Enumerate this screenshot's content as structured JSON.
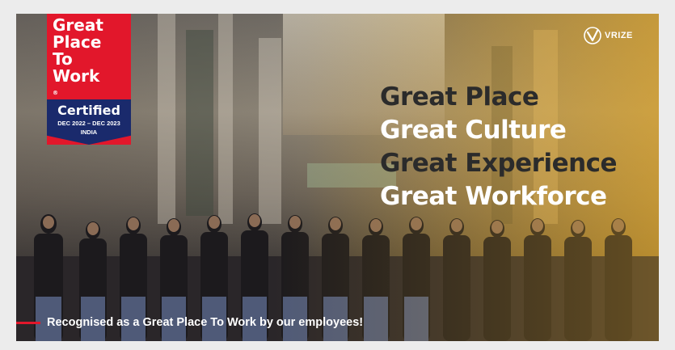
{
  "badge": {
    "line1": "Great",
    "line2": "Place",
    "line3": "To",
    "line4": "Work",
    "registered": "®",
    "certified": "Certified",
    "dates": "DEC 2022 – DEC 2023",
    "country": "INDIA",
    "colors": {
      "red": "#e2172b",
      "navy": "#1a2a6c"
    }
  },
  "logo": {
    "text": "VRIZE",
    "icon": "vrize-logo-icon"
  },
  "headlines": [
    "Great Place",
    "Great Culture",
    "Great Experience",
    "Great Workforce"
  ],
  "caption": "Recognised as a Great Place To Work by our employees!",
  "colors": {
    "accent": "#e2172b",
    "overlay": "#e6aa28"
  }
}
